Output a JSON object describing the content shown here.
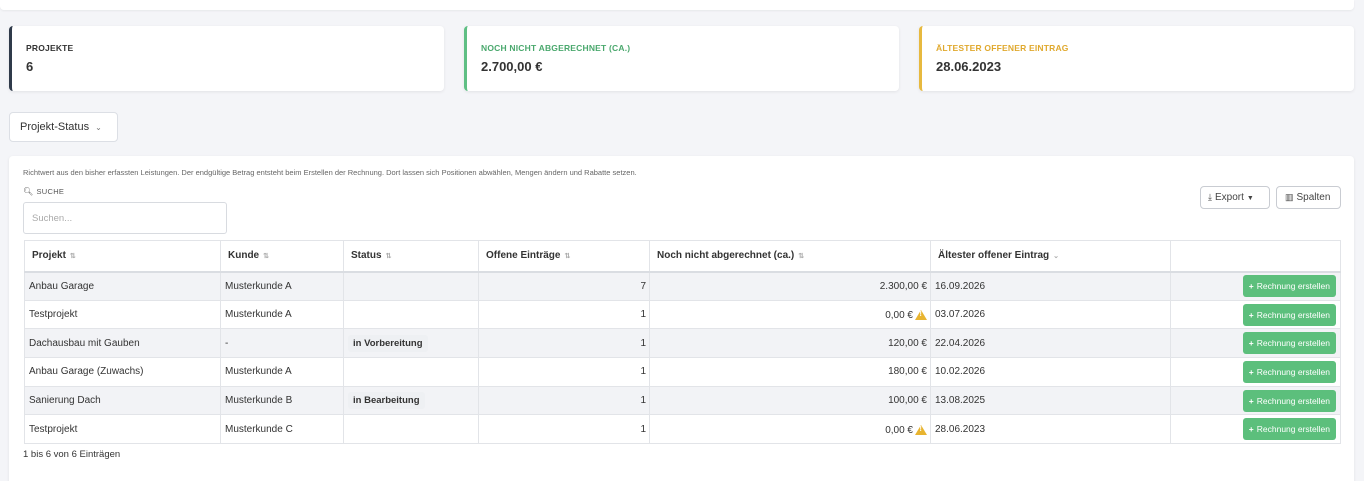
{
  "cards": {
    "projects": {
      "title": "PROJEKTE",
      "value": "6"
    },
    "open": {
      "title": "NOCH NICHT ABGERECHNET (CA.)",
      "value": "2.700,00 €"
    },
    "oldest": {
      "title": "ÄLTESTER OFFENER EINTRAG",
      "value": "28.06.2023"
    }
  },
  "filter": {
    "status_label": "Projekt-Status"
  },
  "panel": {
    "hint": "Richtwert aus den bisher erfassten Leistungen. Der endgültige Betrag entsteht beim Erstellen der Rechnung. Dort lassen sich Positionen abwählen, Mengen ändern und Rabatte setzen.",
    "search_label": "SUCHE",
    "search_placeholder": "Suchen...",
    "export_label": "Export",
    "columns_label": "Spalten",
    "info": "1 bis 6 von 6 Einträgen"
  },
  "table": {
    "headers": [
      "Projekt",
      "Kunde",
      "Status",
      "Offene Einträge",
      "Noch nicht abgerechnet (ca.)",
      "Ältester offener Eintrag",
      ""
    ],
    "rows": [
      {
        "projekt": "Anbau Garage",
        "kunde": "Musterkunde A",
        "status": "",
        "offen": "7",
        "betrag": "2.300,00 €",
        "warn": false,
        "datum": "16.09.2026",
        "action": "Rechnung erstellen"
      },
      {
        "projekt": "Testprojekt",
        "kunde": "Musterkunde A",
        "status": "",
        "offen": "1",
        "betrag": "0,00 €",
        "warn": true,
        "datum": "03.07.2026",
        "action": "Rechnung erstellen"
      },
      {
        "projekt": "Dachausbau mit Gauben",
        "kunde": "-",
        "status": "in Vorbereitung",
        "offen": "1",
        "betrag": "120,00 €",
        "warn": false,
        "datum": "22.04.2026",
        "action": "Rechnung erstellen"
      },
      {
        "projekt": "Anbau Garage (Zuwachs)",
        "kunde": "Musterkunde A",
        "status": "",
        "offen": "1",
        "betrag": "180,00 €",
        "warn": false,
        "datum": "10.02.2026",
        "action": "Rechnung erstellen"
      },
      {
        "projekt": "Sanierung Dach",
        "kunde": "Musterkunde B",
        "status": "in Bearbeitung",
        "offen": "1",
        "betrag": "100,00 €",
        "warn": false,
        "datum": "13.08.2025",
        "action": "Rechnung erstellen"
      },
      {
        "projekt": "Testprojekt",
        "kunde": "Musterkunde C",
        "status": "",
        "offen": "1",
        "betrag": "0,00 €",
        "warn": true,
        "datum": "28.06.2023",
        "action": "Rechnung erstellen"
      }
    ]
  },
  "colors": {
    "accent_green": "#5cbf7c",
    "accent_yellow": "#e7b93f",
    "accent_dark": "#2f3a4a"
  },
  "icons": {
    "search": "search-icon",
    "export": "download-icon",
    "columns": "columns-icon",
    "sort": "sort-icon",
    "warning": "warning-icon",
    "add": "plus-icon"
  }
}
